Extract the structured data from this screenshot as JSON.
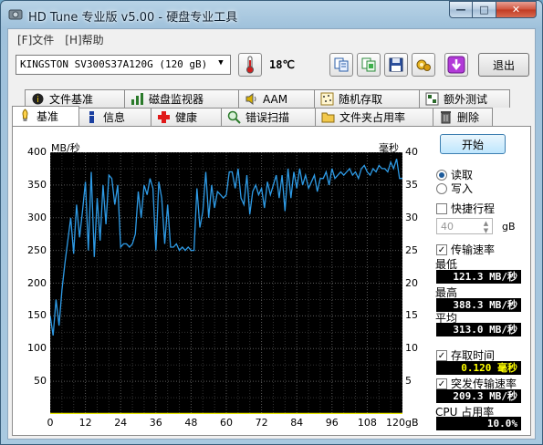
{
  "window": {
    "title": "HD Tune 专业版 v5.00 - 硬盘专业工具",
    "min_symbol": "—",
    "max_symbol": "□",
    "close_symbol": "✕"
  },
  "menu": [
    {
      "label": "[F]文件"
    },
    {
      "label": "[H]帮助"
    }
  ],
  "toolbar": {
    "drive": "KINGSTON SV300S37A120G (120 gB)",
    "temperature": "18℃",
    "exit_label": "退出",
    "icons": [
      "thermometer-icon",
      "copy-text-icon",
      "copy-screenshot-icon",
      "save-icon",
      "options-icon",
      "download-icon"
    ]
  },
  "tabs_top": [
    {
      "label": "文件基准",
      "icon": "file-benchmark-icon"
    },
    {
      "label": "磁盘监视器",
      "icon": "disk-monitor-icon"
    },
    {
      "label": "AAM",
      "icon": "speaker-icon"
    },
    {
      "label": "随机存取",
      "icon": "random-access-icon"
    },
    {
      "label": "额外测试",
      "icon": "extra-tests-icon"
    }
  ],
  "tabs_bottom": [
    {
      "label": "基准",
      "icon": "benchmark-icon",
      "active": true
    },
    {
      "label": "信息",
      "icon": "info-icon"
    },
    {
      "label": "健康",
      "icon": "health-icon"
    },
    {
      "label": "错误扫描",
      "icon": "error-scan-icon"
    },
    {
      "label": "文件夹占用率",
      "icon": "folder-usage-icon"
    },
    {
      "label": "删除",
      "icon": "erase-icon"
    }
  ],
  "controls": {
    "start_label": "开始",
    "read_label": "读取",
    "write_label": "写入",
    "read_selected": true,
    "short_stroke_label": "快捷行程",
    "short_stroke_value": "40",
    "short_stroke_unit": "gB",
    "transfer_rate_label": "传输速率",
    "min_label": "最低",
    "min_value": "121.3 MB/秒",
    "max_label": "最高",
    "max_value": "388.3 MB/秒",
    "avg_label": "平均",
    "avg_value": "313.0 MB/秒",
    "access_time_label": "存取时间",
    "access_time_value": "0.120 毫秒",
    "burst_rate_label": "突发传输速率",
    "burst_rate_value": "209.3 MB/秒",
    "cpu_label": "CPU 占用率",
    "cpu_value": "10.0%"
  },
  "chart_data": {
    "type": "line",
    "ylabel_left": "MB/秒",
    "ylabel_right": "毫秒",
    "y_ticks_left": [
      "400",
      "350",
      "300",
      "250",
      "200",
      "150",
      "100",
      "50"
    ],
    "y_ticks_right": [
      "40",
      "35",
      "30",
      "25",
      "20",
      "15",
      "10",
      "5"
    ],
    "x_ticks": [
      "0",
      "12",
      "24",
      "36",
      "48",
      "60",
      "72",
      "84",
      "96",
      "108",
      "120gB"
    ],
    "ylim_left": [
      0,
      400
    ],
    "ylim_right": [
      0,
      40
    ],
    "xlim": [
      0,
      120
    ],
    "grid": true,
    "series": [
      {
        "color": "#2e9be6",
        "x": [
          0,
          1,
          2,
          3,
          4,
          5,
          6,
          7,
          8,
          9,
          10,
          11,
          12,
          13,
          14,
          15,
          16,
          17,
          18,
          19,
          20,
          21,
          22,
          23,
          24,
          25,
          26,
          27,
          28,
          29,
          30,
          31,
          32,
          33,
          34,
          35,
          36,
          37,
          38,
          39,
          40,
          41,
          42,
          43,
          44,
          45,
          46,
          47,
          48,
          49,
          50,
          51,
          52,
          53,
          54,
          55,
          56,
          57,
          58,
          59,
          60,
          61,
          62,
          63,
          64,
          65,
          66,
          67,
          68,
          69,
          70,
          71,
          72,
          73,
          74,
          75,
          76,
          77,
          78,
          79,
          80,
          81,
          82,
          83,
          84,
          85,
          86,
          87,
          88,
          89,
          90,
          91,
          92,
          93,
          94,
          95,
          96,
          97,
          98,
          99,
          100,
          101,
          102,
          103,
          104,
          105,
          106,
          107,
          108,
          109,
          110,
          111,
          112,
          113,
          114,
          115,
          116,
          117,
          118,
          119,
          120
        ],
        "values": [
          150,
          120,
          175,
          135,
          190,
          230,
          265,
          300,
          245,
          320,
          270,
          310,
          355,
          250,
          370,
          240,
          330,
          265,
          350,
          290,
          365,
          360,
          320,
          350,
          255,
          260,
          260,
          255,
          260,
          275,
          340,
          300,
          350,
          335,
          360,
          345,
          250,
          355,
          330,
          260,
          320,
          255,
          255,
          260,
          250,
          255,
          250,
          255,
          250,
          250,
          345,
          285,
          310,
          370,
          300,
          350,
          315,
          340,
          335,
          330,
          335,
          370,
          370,
          345,
          375,
          330,
          320,
          365,
          305,
          340,
          350,
          335,
          345,
          315,
          355,
          335,
          350,
          365,
          330,
          365,
          310,
          375,
          330,
          370,
          345,
          375,
          350,
          365,
          345,
          355,
          365,
          340,
          360,
          360,
          370,
          350,
          375,
          360,
          365,
          370,
          365,
          370,
          375,
          365,
          370,
          360,
          375,
          380,
          370,
          365,
          375,
          370,
          380,
          375,
          375,
          370,
          385,
          375,
          390,
          360,
          360
        ]
      },
      {
        "color": "#e6e600",
        "x": [
          0,
          120
        ],
        "values": [
          0.4,
          0.4
        ]
      }
    ]
  }
}
